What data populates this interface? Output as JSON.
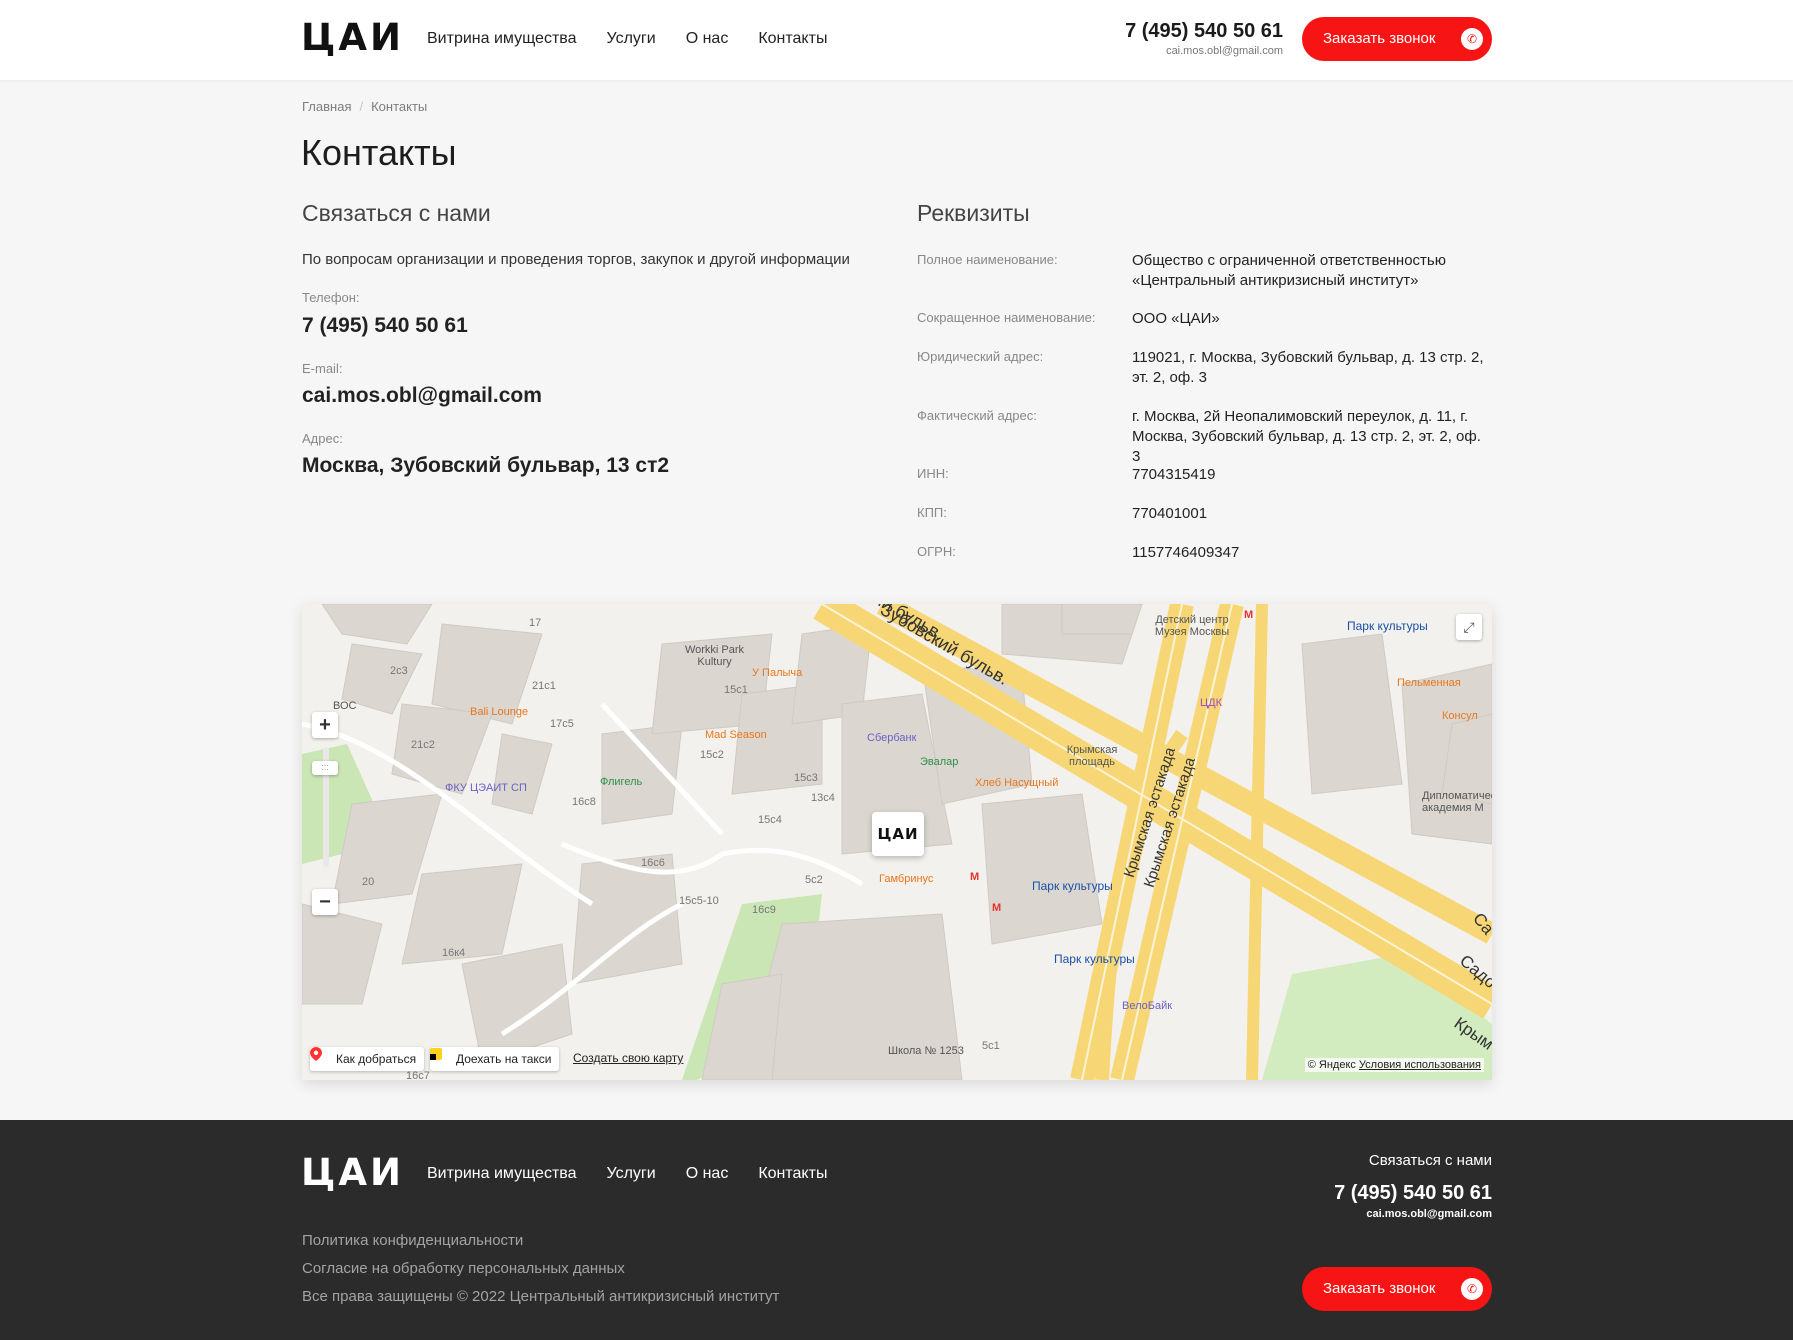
{
  "header": {
    "logo": "ЦАИ",
    "nav": [
      "Витрина имущества",
      "Услуги",
      "О нас",
      "Контакты"
    ],
    "phone": "7 (495) 540 50 61",
    "email": "cai.mos.obl@gmail.com",
    "call_button": "Заказать звонок"
  },
  "breadcrumb": {
    "home": "Главная",
    "current": "Контакты"
  },
  "page_title": "Контакты",
  "contact": {
    "title": "Связаться с нами",
    "intro": "По вопросам организации и проведения торгов, закупок и другой информации",
    "phone_label": "Телефон:",
    "phone": "7 (495) 540 50 61",
    "email_label": "E-mail:",
    "email": "cai.mos.obl@gmail.com",
    "address_label": "Адрес:",
    "address": "Москва, Зубовский бульвар, 13 ст2"
  },
  "requisites": {
    "title": "Реквизиты",
    "rows": [
      {
        "label": "Полное наименование:",
        "value": "Общество с ограниченной ответственностью «Центральный антикризисный институт»"
      },
      {
        "label": "Сокращенное наименование:",
        "value": "ООО «ЦАИ»"
      },
      {
        "label": "Юридический адрес:",
        "value": "119021, г. Москва, Зубовский бульвар, д. 13 стр. 2, эт. 2, оф. 3"
      },
      {
        "label": "Фактический адрес:",
        "value": "г. Москва, 2й Неопалимовский переулок, д. 11, г. Москва, Зубовский бульвар, д. 13 стр. 2, эт. 2, оф. 3"
      },
      {
        "label": "ИНН:",
        "value": "7704315419"
      },
      {
        "label": "КПП:",
        "value": "770401001"
      },
      {
        "label": "ОГРН:",
        "value": "1157746409347"
      }
    ]
  },
  "map": {
    "marker": "ЦАИ",
    "route_button": "Как добраться",
    "taxi_button": "Доехать на такси",
    "create_map_link": "Создать свою карту",
    "copyright": "© Яндекс",
    "terms": "Условия использования",
    "labels": {
      "street1": "Зубовский бульв.",
      "street2": "Крымская эстакада",
      "street3": "Крымская эстакада",
      "street_left": "кий бульв.",
      "square": "Крымская площадь",
      "metro1": "Парк культуры",
      "metro2": "Парк культуры",
      "metro3": "Парк культуры",
      "poi1": "Bali Lounge",
      "poi2": "Mad Season",
      "poi3": "У Палыча",
      "poi4": "Workki Park Kultury",
      "poi5": "Флигель",
      "poi6": "ФКУ ЦЭАИТ СП",
      "poi7": "Сбербанк",
      "poi8": "Эвалар",
      "poi9": "Хлеб Насущный",
      "poi10": "Гамбринус",
      "poi11": "ЦДК",
      "poi12": "Пельменная",
      "poi13": "Консул",
      "poi14": "Детский центр Музея Москвы",
      "poi15": "Дипломатическая академия М",
      "poi16": "ВелоБайк",
      "poi17": "Школа № 1253",
      "poi18": "ВОС",
      "house1": "17",
      "house2": "2с3",
      "house3": "21с1",
      "house4": "17с5",
      "house5": "21с2",
      "house6": "15с1",
      "house7": "15с2",
      "house8": "15с3",
      "house9": "13с4",
      "house10": "15с4",
      "house11": "16с8",
      "house12": "16с6",
      "house13": "5с2",
      "house14": "15с5-10",
      "house15": "16с9",
      "house16": "20",
      "house17": "16к4",
      "house18": "5с1",
      "house19": "16с7",
      "street_right": "Са",
      "street_right2": "Садо",
      "street_right3": "Крым"
    }
  },
  "footer": {
    "logo": "ЦАИ",
    "nav": [
      "Витрина имущества",
      "Услуги",
      "О нас",
      "Контакты"
    ],
    "links": [
      "Политика конфиденциальности",
      "Согласие на обработку персональных данных",
      "Все права защищены © 2022 Центральный антикризисный институт"
    ],
    "contact_title": "Связаться с нами",
    "phone": "7 (495) 540 50 61",
    "email": "cai.mos.obl@gmail.com",
    "call_button": "Заказать звонок"
  },
  "colors": {
    "accent": "#f71414",
    "footer_bg": "#2b2b2b",
    "page_bg": "#f6f6f6",
    "road": "#f7d775"
  },
  "icons": [
    "phone-icon",
    "route-pin-icon",
    "taxi-icon",
    "fullscreen-icon",
    "zoom-in-icon",
    "zoom-out-icon",
    "metro-icon"
  ]
}
